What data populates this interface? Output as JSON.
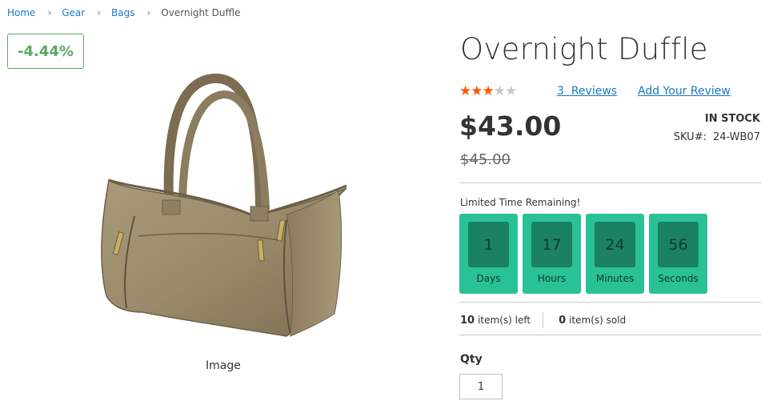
{
  "breadcrumb": {
    "items": [
      "Home",
      "Gear",
      "Bags"
    ],
    "current": "Overnight Duffle",
    "separator": "›"
  },
  "badge": {
    "discount": "-4.44%"
  },
  "image": {
    "caption": "Image"
  },
  "product": {
    "title": "Overnight Duffle",
    "rating_stars_filled": 3,
    "rating_stars_total": 5,
    "reviews_count": "3",
    "reviews_label": "Reviews",
    "add_review": "Add Your Review",
    "price": "$43.00",
    "old_price": "$45.00",
    "stock": "In stock",
    "sku_label": "SKU#:",
    "sku_value": "24-WB07"
  },
  "countdown": {
    "label": "Limited Time Remaining!",
    "units": [
      {
        "value": "1",
        "label": "Days"
      },
      {
        "value": "17",
        "label": "Hours"
      },
      {
        "value": "24",
        "label": "Minutes"
      },
      {
        "value": "56",
        "label": "Seconds"
      }
    ]
  },
  "stats": {
    "left_count": "10",
    "left_label": "item(s) left",
    "sold_count": "0",
    "sold_label": "item(s) sold"
  },
  "qty": {
    "label": "Qty",
    "value": "1"
  },
  "colors": {
    "link": "#1979c3",
    "badge_green": "#5aa85f",
    "star": "#ff5501",
    "countdown_bg": "#2ac196",
    "countdown_inner": "#1a8165"
  }
}
